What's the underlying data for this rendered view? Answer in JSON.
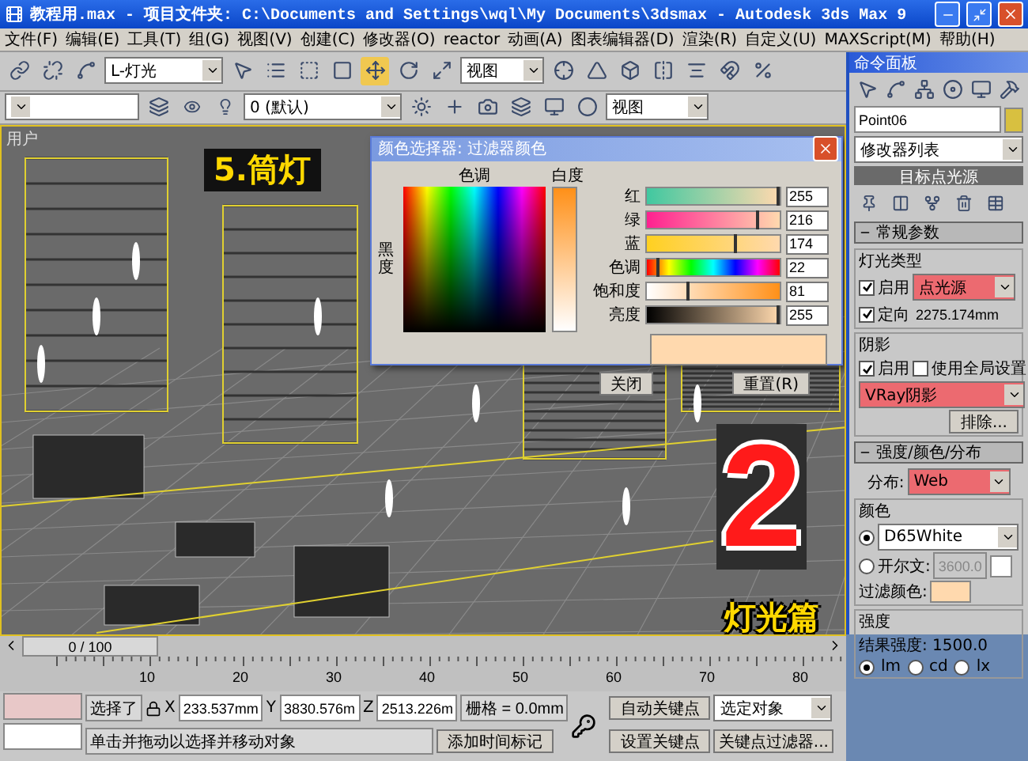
{
  "window": {
    "title": "教程用.max    - 项目文件夹: C:\\Documents and Settings\\wql\\My Documents\\3dsmax    - Autodesk 3ds Max 9"
  },
  "menu": [
    "文件(F)",
    "编辑(E)",
    "工具(T)",
    "组(G)",
    "视图(V)",
    "创建(C)",
    "修改器(O)",
    "reactor",
    "动画(A)",
    "图表编辑器(D)",
    "渲染(R)",
    "自定义(U)",
    "MAXScript(M)",
    "帮助(H)"
  ],
  "toolbar": {
    "selection_filter": "L-灯光",
    "coord_system": "视图",
    "layer": "0 (默认)",
    "named_view": "视图",
    "transform_tools": [
      {
        "kind": "move",
        "selected": true
      },
      {
        "kind": "rotate",
        "selected": false
      },
      {
        "kind": "scale",
        "selected": false
      }
    ]
  },
  "viewport": {
    "label": "用户",
    "overlay_title": "5.筒灯",
    "big_number": "2",
    "caption": "灯光篇"
  },
  "color_dialog": {
    "title": "颜色选择器: 过滤器颜色",
    "hue_label": "色调",
    "whiteness_label": "白度",
    "blackness_label": "黑度",
    "channels": [
      {
        "label": "红",
        "value": "255",
        "level": 1.0
      },
      {
        "label": "绿",
        "value": "216",
        "level": 0.85
      },
      {
        "label": "蓝",
        "value": "174",
        "level": 0.68
      },
      {
        "label": "色调",
        "value": "22",
        "level": 0.09
      },
      {
        "label": "饱和度",
        "value": "81",
        "level": 0.32
      },
      {
        "label": "亮度",
        "value": "255",
        "level": 1.0
      }
    ],
    "buttons": [
      "关闭",
      "重置(R)"
    ]
  },
  "command_panel": {
    "title": "命令面板",
    "object_name": "Point06",
    "modifier_list": "修改器列表",
    "modifier": "目标点光源",
    "general": {
      "heading": "常规参数",
      "expanded": true,
      "light_type_group": "灯光类型",
      "light_on": {
        "label": "启用",
        "checked": true
      },
      "light_type": {
        "value": "点光源",
        "highlighted": true
      },
      "targeted": {
        "label": "定向",
        "checked": true
      },
      "target_distance": "2275.174mm",
      "shadow_group": "阴影",
      "shadow_on": {
        "label": "启用",
        "checked": true
      },
      "global": {
        "label": "使用全局设置",
        "checked": false
      },
      "shadow_type": {
        "value": "VRay阴影",
        "highlighted": true
      },
      "exclude_button": "排除..."
    },
    "intensity": {
      "heading": "强度/颜色/分布",
      "expanded": true,
      "distribution_label": "分布:",
      "distribution": {
        "value": "Web",
        "highlighted": true
      },
      "color_group": "颜色",
      "color_options": [
        {
          "kind": "preset",
          "label": "D65White",
          "selected": true
        },
        {
          "kind": "kelvin",
          "label": "开尔文:",
          "value": "3600.0",
          "selected": false
        }
      ],
      "filter_label": "过滤颜色:",
      "intensity_group": "强度",
      "result": "结果强度: 1500.0",
      "units": [
        {
          "label": "lm",
          "selected": true
        },
        {
          "label": "cd",
          "selected": false
        },
        {
          "label": "lx",
          "selected": false
        }
      ]
    }
  },
  "timeline": {
    "position": "0 / 100",
    "level": 0
  },
  "ruler_ticks": [
    "10",
    "20",
    "30",
    "40",
    "50",
    "60",
    "70",
    "80"
  ],
  "status": {
    "selection": "选择了",
    "x_label": "X",
    "x": "233.537mm",
    "y_label": "Y",
    "y": "3830.576m",
    "z_label": "Z",
    "z": "2513.226m",
    "grid": "栅格 = 0.0mm",
    "prompt": "单击并拖动以选择并移动对象",
    "time_tag": "添加时间标记",
    "auto_key": "自动关键点",
    "key_mode": "选定对象",
    "set_key": "设置关键点",
    "key_filters": "关键点过滤器..."
  }
}
